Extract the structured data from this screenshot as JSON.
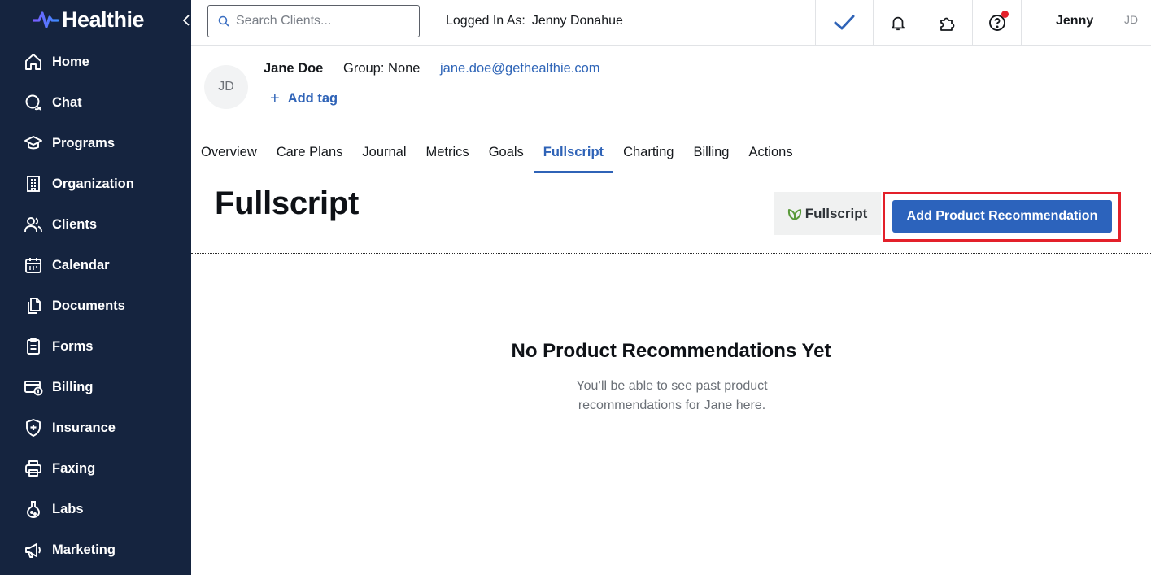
{
  "app": {
    "brand": "Healthie"
  },
  "sidebar": {
    "items": [
      {
        "label": "Home",
        "icon": "home-icon"
      },
      {
        "label": "Chat",
        "icon": "chat-icon"
      },
      {
        "label": "Programs",
        "icon": "programs-icon"
      },
      {
        "label": "Organization",
        "icon": "organization-icon"
      },
      {
        "label": "Clients",
        "icon": "clients-icon"
      },
      {
        "label": "Calendar",
        "icon": "calendar-icon"
      },
      {
        "label": "Documents",
        "icon": "documents-icon"
      },
      {
        "label": "Forms",
        "icon": "forms-icon"
      },
      {
        "label": "Billing",
        "icon": "billing-icon"
      },
      {
        "label": "Insurance",
        "icon": "insurance-icon"
      },
      {
        "label": "Faxing",
        "icon": "faxing-icon"
      },
      {
        "label": "Labs",
        "icon": "labs-icon"
      },
      {
        "label": "Marketing",
        "icon": "marketing-icon"
      }
    ]
  },
  "topbar": {
    "search_placeholder": "Search Clients...",
    "logged_in_label": "Logged In As:",
    "logged_in_user": "Jenny Donahue",
    "user_name": "Jenny",
    "user_initials": "JD"
  },
  "client": {
    "initials": "JD",
    "name": "Jane Doe",
    "group": "Group: None",
    "email": "jane.doe@gethealthie.com",
    "add_tag_label": "Add tag"
  },
  "tabs": [
    {
      "label": "Overview",
      "active": false
    },
    {
      "label": "Care Plans",
      "active": false
    },
    {
      "label": "Journal",
      "active": false
    },
    {
      "label": "Metrics",
      "active": false
    },
    {
      "label": "Goals",
      "active": false
    },
    {
      "label": "Fullscript",
      "active": true
    },
    {
      "label": "Charting",
      "active": false
    },
    {
      "label": "Billing",
      "active": false
    },
    {
      "label": "Actions",
      "active": false
    }
  ],
  "section": {
    "title": "Fullscript",
    "partner_logo_text": "Fullscript",
    "add_button_label": "Add Product Recommendation"
  },
  "empty_state": {
    "title": "No Product Recommendations Yet",
    "description": "You’ll be able to see past product recommendations for Jane here."
  },
  "colors": {
    "sidebar_bg": "#15243f",
    "accent": "#2f63b7",
    "highlight": "#e3202a",
    "notification_dot": "#e3202a",
    "fullscript_green": "#5a9a3a"
  }
}
